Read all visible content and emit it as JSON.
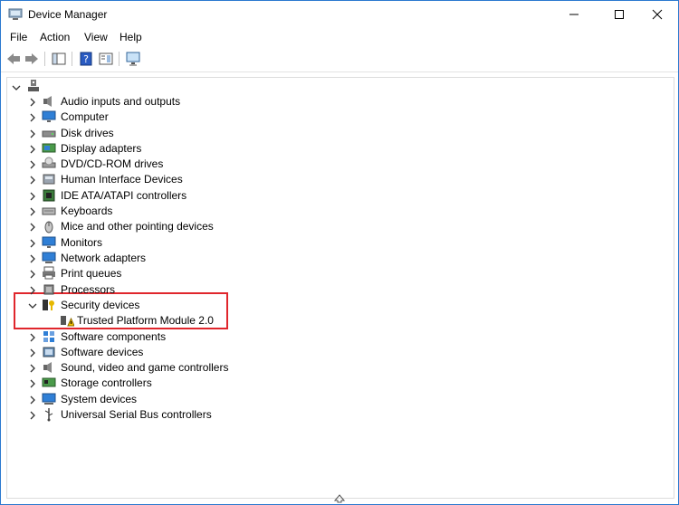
{
  "window": {
    "title": "Device Manager"
  },
  "menu": {
    "items": [
      "File",
      "Action",
      "View",
      "Help"
    ]
  },
  "toolbar": {
    "buttons": [
      "back-arrow-icon",
      "forward-arrow-icon",
      "show-hide-console-icon",
      "help-icon",
      "properties-pane-icon",
      "monitor-scan-icon"
    ]
  },
  "tree": {
    "root": {
      "icon": "computer-root-icon",
      "expanded": true
    },
    "categories": [
      {
        "label": "Audio inputs and outputs",
        "icon": "speaker-icon"
      },
      {
        "label": "Computer",
        "icon": "monitor-icon"
      },
      {
        "label": "Disk drives",
        "icon": "disk-drive-icon"
      },
      {
        "label": "Display adapters",
        "icon": "display-adapter-icon"
      },
      {
        "label": "DVD/CD-ROM drives",
        "icon": "dvd-drive-icon"
      },
      {
        "label": "Human Interface Devices",
        "icon": "hid-icon"
      },
      {
        "label": "IDE ATA/ATAPI controllers",
        "icon": "ide-controller-icon"
      },
      {
        "label": "Keyboards",
        "icon": "keyboard-icon"
      },
      {
        "label": "Mice and other pointing devices",
        "icon": "mouse-icon"
      },
      {
        "label": "Monitors",
        "icon": "monitor-icon"
      },
      {
        "label": "Network adapters",
        "icon": "network-adapter-icon"
      },
      {
        "label": "Print queues",
        "icon": "printer-icon"
      },
      {
        "label": "Processors",
        "icon": "processor-icon"
      },
      {
        "label": "Security devices",
        "icon": "security-device-icon",
        "expanded": true,
        "children": [
          {
            "label": "Trusted Platform Module 2.0",
            "icon": "warning-device-icon"
          }
        ]
      },
      {
        "label": "Software components",
        "icon": "software-component-icon"
      },
      {
        "label": "Software devices",
        "icon": "software-device-icon"
      },
      {
        "label": "Sound, video and game controllers",
        "icon": "speaker-icon"
      },
      {
        "label": "Storage controllers",
        "icon": "storage-controller-icon"
      },
      {
        "label": "System devices",
        "icon": "system-device-icon"
      },
      {
        "label": "Universal Serial Bus controllers",
        "icon": "usb-icon"
      }
    ]
  },
  "colors": {
    "highlight_border": "#e0262c",
    "window_border": "#2b79d0"
  }
}
